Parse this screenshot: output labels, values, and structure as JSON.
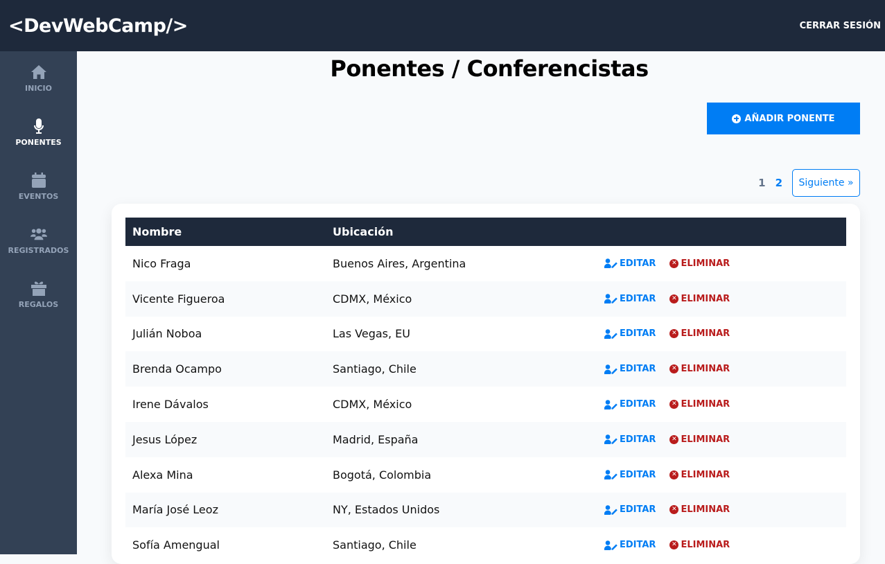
{
  "header": {
    "logo": "<DevWebCamp/>",
    "logout_label": "Cerrar Sesión"
  },
  "sidebar": {
    "items": [
      {
        "label": "Inicio",
        "icon": "home-icon",
        "active": false
      },
      {
        "label": "Ponentes",
        "icon": "microphone-icon",
        "active": true
      },
      {
        "label": "Eventos",
        "icon": "calendar-icon",
        "active": false
      },
      {
        "label": "Registrados",
        "icon": "users-icon",
        "active": false
      },
      {
        "label": "Regalos",
        "icon": "gift-icon",
        "active": false
      }
    ]
  },
  "main": {
    "title": "Ponentes / Conferencistas",
    "add_button_label": "Añadir Ponente",
    "pagination": {
      "pages": [
        "1",
        "2"
      ],
      "current": "1",
      "next_label": "Siguiente »"
    }
  },
  "table": {
    "columns": [
      "Nombre",
      "Ubicación"
    ],
    "edit_label": "Editar",
    "delete_label": "Eliminar",
    "rows": [
      {
        "name": "Nico Fraga",
        "location": "Buenos Aires, Argentina"
      },
      {
        "name": "Vicente Figueroa",
        "location": "CDMX, México"
      },
      {
        "name": "Julián Noboa",
        "location": "Las Vegas, EU"
      },
      {
        "name": "Brenda Ocampo",
        "location": "Santiago, Chile"
      },
      {
        "name": "Irene Dávalos",
        "location": "CDMX, México"
      },
      {
        "name": "Jesus López",
        "location": "Madrid, España"
      },
      {
        "name": "Alexa Mina",
        "location": "Bogotá, Colombia"
      },
      {
        "name": "María José Leoz",
        "location": "NY, Estados Unidos"
      },
      {
        "name": "Sofía Amengual",
        "location": "Santiago, Chile"
      }
    ]
  },
  "colors": {
    "header_bg": "#1e293b",
    "sidebar_bg": "#334155",
    "accent": "#007df4",
    "danger": "#b91c1c"
  }
}
